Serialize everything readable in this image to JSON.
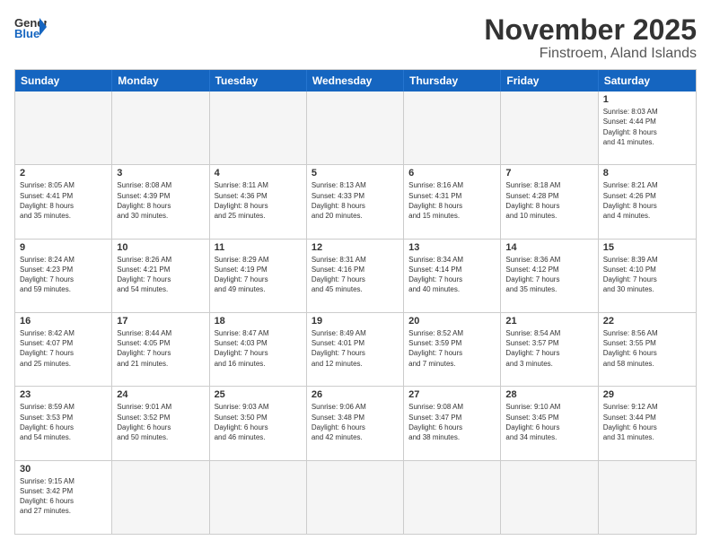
{
  "header": {
    "logo_general": "General",
    "logo_blue": "Blue",
    "month": "November 2025",
    "location": "Finstroem, Aland Islands"
  },
  "weekdays": [
    "Sunday",
    "Monday",
    "Tuesday",
    "Wednesday",
    "Thursday",
    "Friday",
    "Saturday"
  ],
  "rows": [
    [
      {
        "day": "",
        "text": "",
        "empty": true
      },
      {
        "day": "",
        "text": "",
        "empty": true
      },
      {
        "day": "",
        "text": "",
        "empty": true
      },
      {
        "day": "",
        "text": "",
        "empty": true
      },
      {
        "day": "",
        "text": "",
        "empty": true
      },
      {
        "day": "",
        "text": "",
        "empty": true
      },
      {
        "day": "1",
        "text": "Sunrise: 8:03 AM\nSunset: 4:44 PM\nDaylight: 8 hours\nand 41 minutes.",
        "empty": false
      }
    ],
    [
      {
        "day": "2",
        "text": "Sunrise: 8:05 AM\nSunset: 4:41 PM\nDaylight: 8 hours\nand 35 minutes.",
        "empty": false
      },
      {
        "day": "3",
        "text": "Sunrise: 8:08 AM\nSunset: 4:39 PM\nDaylight: 8 hours\nand 30 minutes.",
        "empty": false
      },
      {
        "day": "4",
        "text": "Sunrise: 8:11 AM\nSunset: 4:36 PM\nDaylight: 8 hours\nand 25 minutes.",
        "empty": false
      },
      {
        "day": "5",
        "text": "Sunrise: 8:13 AM\nSunset: 4:33 PM\nDaylight: 8 hours\nand 20 minutes.",
        "empty": false
      },
      {
        "day": "6",
        "text": "Sunrise: 8:16 AM\nSunset: 4:31 PM\nDaylight: 8 hours\nand 15 minutes.",
        "empty": false
      },
      {
        "day": "7",
        "text": "Sunrise: 8:18 AM\nSunset: 4:28 PM\nDaylight: 8 hours\nand 10 minutes.",
        "empty": false
      },
      {
        "day": "8",
        "text": "Sunrise: 8:21 AM\nSunset: 4:26 PM\nDaylight: 8 hours\nand 4 minutes.",
        "empty": false
      }
    ],
    [
      {
        "day": "9",
        "text": "Sunrise: 8:24 AM\nSunset: 4:23 PM\nDaylight: 7 hours\nand 59 minutes.",
        "empty": false
      },
      {
        "day": "10",
        "text": "Sunrise: 8:26 AM\nSunset: 4:21 PM\nDaylight: 7 hours\nand 54 minutes.",
        "empty": false
      },
      {
        "day": "11",
        "text": "Sunrise: 8:29 AM\nSunset: 4:19 PM\nDaylight: 7 hours\nand 49 minutes.",
        "empty": false
      },
      {
        "day": "12",
        "text": "Sunrise: 8:31 AM\nSunset: 4:16 PM\nDaylight: 7 hours\nand 45 minutes.",
        "empty": false
      },
      {
        "day": "13",
        "text": "Sunrise: 8:34 AM\nSunset: 4:14 PM\nDaylight: 7 hours\nand 40 minutes.",
        "empty": false
      },
      {
        "day": "14",
        "text": "Sunrise: 8:36 AM\nSunset: 4:12 PM\nDaylight: 7 hours\nand 35 minutes.",
        "empty": false
      },
      {
        "day": "15",
        "text": "Sunrise: 8:39 AM\nSunset: 4:10 PM\nDaylight: 7 hours\nand 30 minutes.",
        "empty": false
      }
    ],
    [
      {
        "day": "16",
        "text": "Sunrise: 8:42 AM\nSunset: 4:07 PM\nDaylight: 7 hours\nand 25 minutes.",
        "empty": false
      },
      {
        "day": "17",
        "text": "Sunrise: 8:44 AM\nSunset: 4:05 PM\nDaylight: 7 hours\nand 21 minutes.",
        "empty": false
      },
      {
        "day": "18",
        "text": "Sunrise: 8:47 AM\nSunset: 4:03 PM\nDaylight: 7 hours\nand 16 minutes.",
        "empty": false
      },
      {
        "day": "19",
        "text": "Sunrise: 8:49 AM\nSunset: 4:01 PM\nDaylight: 7 hours\nand 12 minutes.",
        "empty": false
      },
      {
        "day": "20",
        "text": "Sunrise: 8:52 AM\nSunset: 3:59 PM\nDaylight: 7 hours\nand 7 minutes.",
        "empty": false
      },
      {
        "day": "21",
        "text": "Sunrise: 8:54 AM\nSunset: 3:57 PM\nDaylight: 7 hours\nand 3 minutes.",
        "empty": false
      },
      {
        "day": "22",
        "text": "Sunrise: 8:56 AM\nSunset: 3:55 PM\nDaylight: 6 hours\nand 58 minutes.",
        "empty": false
      }
    ],
    [
      {
        "day": "23",
        "text": "Sunrise: 8:59 AM\nSunset: 3:53 PM\nDaylight: 6 hours\nand 54 minutes.",
        "empty": false
      },
      {
        "day": "24",
        "text": "Sunrise: 9:01 AM\nSunset: 3:52 PM\nDaylight: 6 hours\nand 50 minutes.",
        "empty": false
      },
      {
        "day": "25",
        "text": "Sunrise: 9:03 AM\nSunset: 3:50 PM\nDaylight: 6 hours\nand 46 minutes.",
        "empty": false
      },
      {
        "day": "26",
        "text": "Sunrise: 9:06 AM\nSunset: 3:48 PM\nDaylight: 6 hours\nand 42 minutes.",
        "empty": false
      },
      {
        "day": "27",
        "text": "Sunrise: 9:08 AM\nSunset: 3:47 PM\nDaylight: 6 hours\nand 38 minutes.",
        "empty": false
      },
      {
        "day": "28",
        "text": "Sunrise: 9:10 AM\nSunset: 3:45 PM\nDaylight: 6 hours\nand 34 minutes.",
        "empty": false
      },
      {
        "day": "29",
        "text": "Sunrise: 9:12 AM\nSunset: 3:44 PM\nDaylight: 6 hours\nand 31 minutes.",
        "empty": false
      }
    ],
    [
      {
        "day": "30",
        "text": "Sunrise: 9:15 AM\nSunset: 3:42 PM\nDaylight: 6 hours\nand 27 minutes.",
        "empty": false
      },
      {
        "day": "",
        "text": "",
        "empty": true
      },
      {
        "day": "",
        "text": "",
        "empty": true
      },
      {
        "day": "",
        "text": "",
        "empty": true
      },
      {
        "day": "",
        "text": "",
        "empty": true
      },
      {
        "day": "",
        "text": "",
        "empty": true
      },
      {
        "day": "",
        "text": "",
        "empty": true
      }
    ]
  ]
}
